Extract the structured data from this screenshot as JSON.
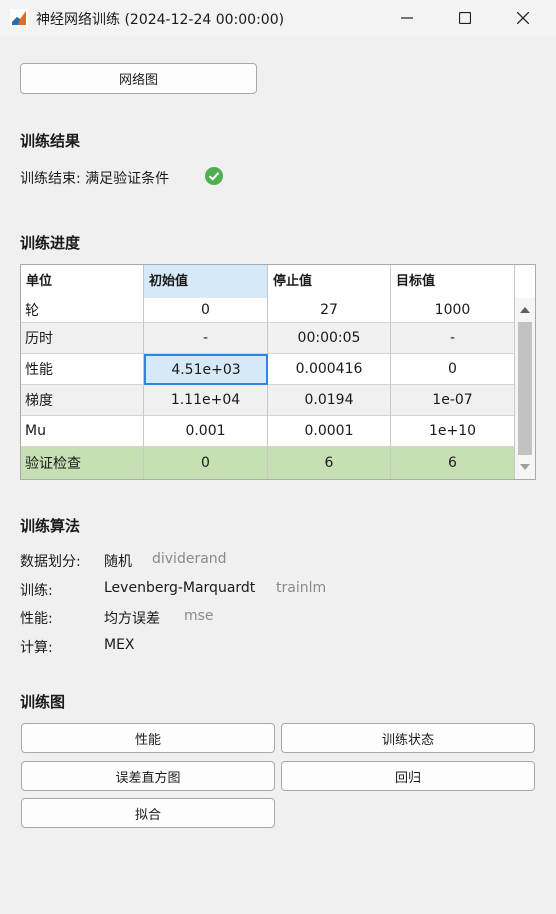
{
  "window": {
    "title": "神经网络训练 (2024-12-24 00:00:00)"
  },
  "network_button": "网络图",
  "results": {
    "title": "训练结果",
    "status": "训练结束: 满足验证条件"
  },
  "progress": {
    "title": "训练进度",
    "headers": [
      "单位",
      "初始值",
      "停止值",
      "目标值"
    ],
    "rows": [
      [
        "轮",
        "0",
        "27",
        "1000"
      ],
      [
        "历时",
        "-",
        "00:00:05",
        "-"
      ],
      [
        "性能",
        "4.51e+03",
        "0.000416",
        "0"
      ],
      [
        "梯度",
        "1.11e+04",
        "0.0194",
        "1e-07"
      ],
      [
        "Mu",
        "0.001",
        "0.0001",
        "1e+10"
      ],
      [
        "验证检查",
        "0",
        "6",
        "6"
      ]
    ]
  },
  "algorithms": {
    "title": "训练算法",
    "items": [
      {
        "label": "数据划分:",
        "value": "随机",
        "code": "dividerand"
      },
      {
        "label": "训练:",
        "value": "Levenberg-Marquardt",
        "code": "trainlm"
      },
      {
        "label": "性能:",
        "value": "均方误差",
        "code": "mse"
      },
      {
        "label": "计算:",
        "value": "MEX",
        "code": ""
      }
    ]
  },
  "plots": {
    "title": "训练图",
    "buttons": [
      "性能",
      "训练状态",
      "误差直方图",
      "回归",
      "拟合"
    ]
  },
  "colors": {
    "check_row": "#c6e0b4",
    "selected_header": "#d6e9f8",
    "selected_cell_border": "#2e86de",
    "success": "#4caf50"
  }
}
